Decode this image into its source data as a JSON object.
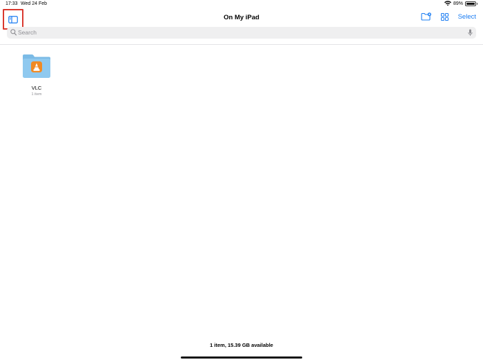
{
  "status_bar": {
    "time": "17:33",
    "date": "Wed 24 Feb",
    "battery_text": "89%",
    "battery_level": 0.89
  },
  "nav": {
    "title": "On My iPad",
    "select_label": "Select",
    "icons": [
      "sidebar-toggle-icon",
      "new-folder-icon",
      "grid-view-icon"
    ]
  },
  "search": {
    "placeholder": "Search"
  },
  "items": [
    {
      "name": "VLC",
      "subtitle": "1 item",
      "icon": "vlc-folder-icon"
    }
  ],
  "footer": {
    "storage_text": "1 item, 15.39 GB available"
  },
  "colors": {
    "accent": "#1a7cf2",
    "highlight_box": "#d9382e",
    "folder": "#8fc9ef",
    "vlc_orange": "#f08a24"
  }
}
